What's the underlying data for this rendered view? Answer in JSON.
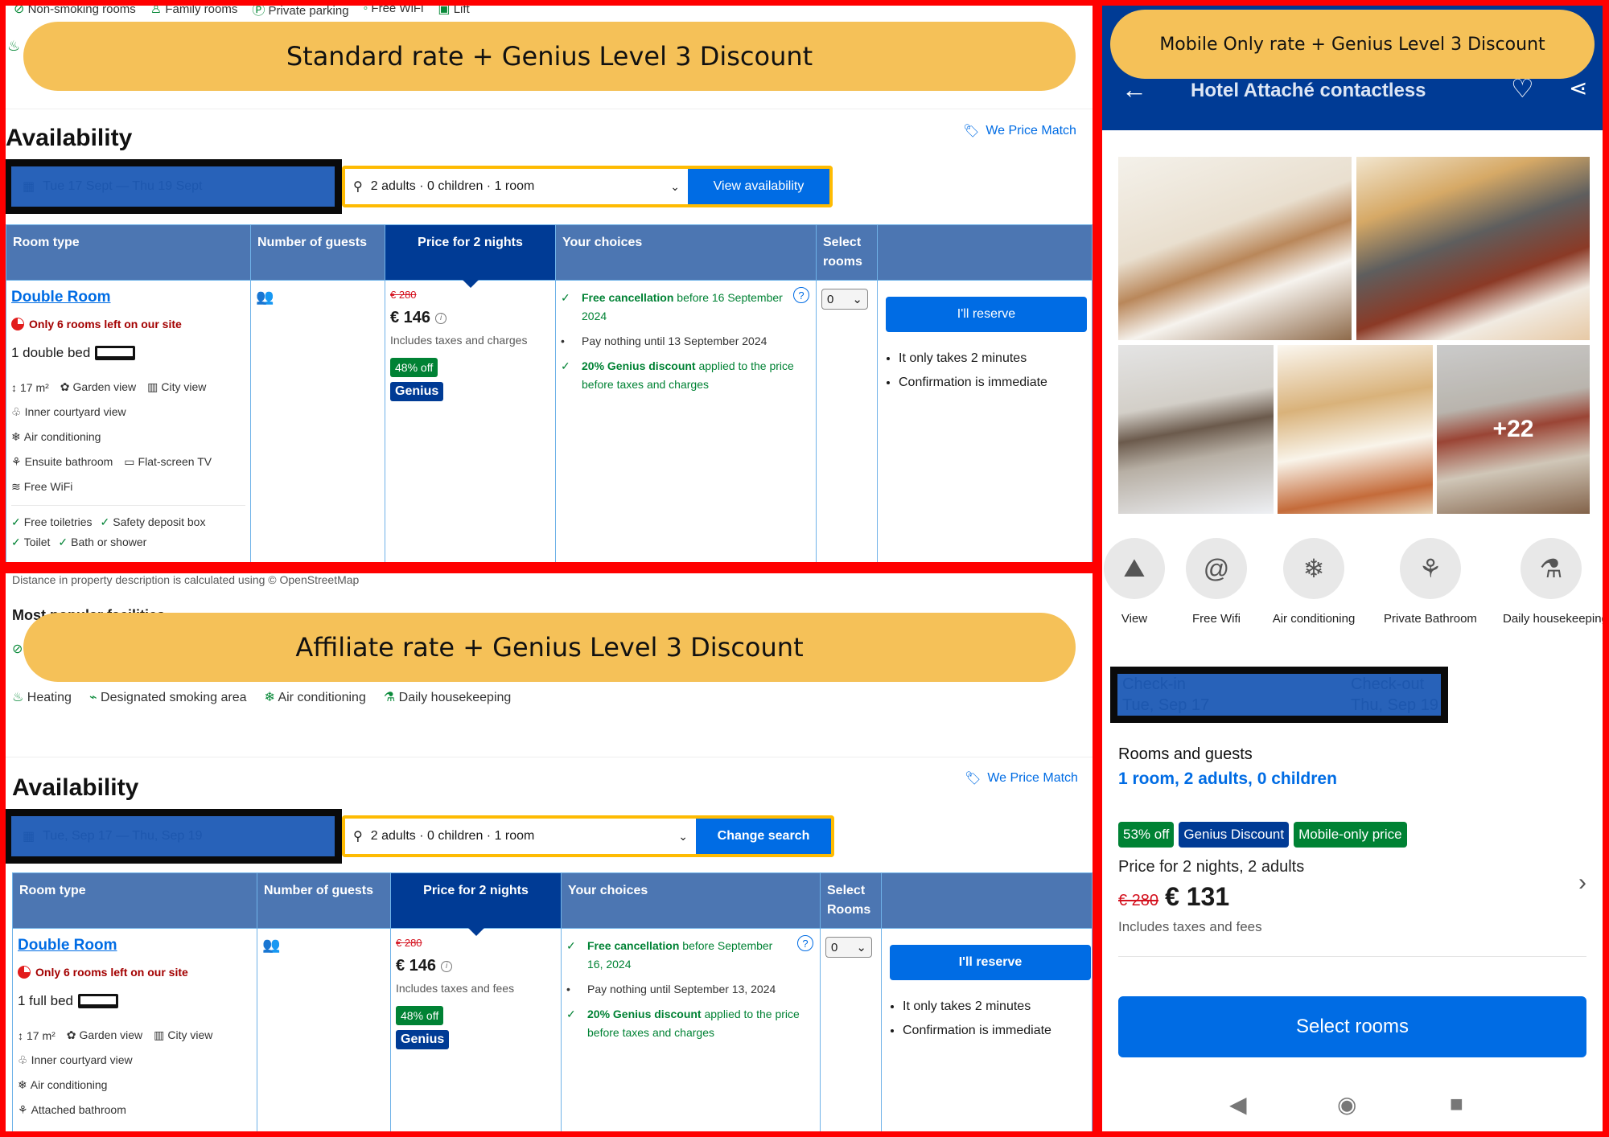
{
  "panels": {
    "standard": {
      "banner": "Standard rate + Genius Level 3 Discount",
      "top_facilities": [
        "Non-smoking rooms",
        "Family rooms",
        "Private parking",
        "Free WiFi",
        "Lift"
      ],
      "availability_title": "Availability",
      "price_match": "We Price Match",
      "dates": "Tue 17 Sept — Thu 19 Sept",
      "guests": "2 adults · 0 children · 1 room",
      "search_button": "View availability",
      "headers": [
        "Room type",
        "Number of guests",
        "Price for 2 nights",
        "Your choices",
        "Select rooms",
        ""
      ],
      "room": {
        "name": "Double Room",
        "scarcity": "Only 6 rooms left on our site",
        "bed": "1 double bed",
        "size": "17 m²",
        "facilities_rows": [
          [
            "17 m²",
            "Garden view",
            "City view"
          ],
          [
            "Inner courtyard view"
          ],
          [
            "Air conditioning"
          ],
          [
            "Ensuite bathroom",
            "Flat-screen TV"
          ],
          [
            "Free WiFi"
          ]
        ],
        "checks": [
          [
            "Free toiletries",
            "Safety deposit box"
          ],
          [
            "Toilet",
            "Bath or shower"
          ]
        ],
        "old_price": "€ 280",
        "price": "€ 146",
        "tax_note": "Includes taxes and charges",
        "discount_badge": "48% off",
        "genius_badge": "Genius",
        "choice1_bold": "Free cancellation",
        "choice1_rest": " before 16 September 2024",
        "choice2": "Pay nothing until 13 September 2024",
        "choice3_bold": "20% Genius discount",
        "choice3_rest": " applied to the price before taxes and charges",
        "qty": "0",
        "reserve": "I'll reserve",
        "bullets": [
          "It only takes 2 minutes",
          "Confirmation is immediate"
        ]
      }
    },
    "affiliate": {
      "banner": "Affiliate rate + Genius Level 3 Discount",
      "osm_note": "Distance in property description is calculated using © OpenStreetMap",
      "most_popular": "Most popular facilities",
      "facilities": [
        "Heating",
        "Designated smoking area",
        "Air conditioning",
        "Daily housekeeping"
      ],
      "availability_title": "Availability",
      "price_match": "We Price Match",
      "dates": "Tue, Sep 17 — Thu, Sep 19",
      "guests": "2 adults · 0 children · 1 room",
      "search_button": "Change search",
      "headers": [
        "Room type",
        "Number of guests",
        "Price for 2 nights",
        "Your choices",
        "Select Rooms",
        ""
      ],
      "room": {
        "name": "Double Room",
        "scarcity": "Only 6 rooms left on our site",
        "bed": "1 full bed",
        "facilities_rows": [
          [
            "17 m²",
            "Garden view",
            "City view"
          ],
          [
            "Inner courtyard view"
          ],
          [
            "Air conditioning"
          ],
          [
            "Attached bathroom"
          ]
        ],
        "old_price": "€ 280",
        "price": "€ 146",
        "tax_note": "Includes taxes and fees",
        "discount_badge": "48% off",
        "genius_badge": "Genius",
        "choice1_bold": "Free cancellation",
        "choice1_rest": " before September 16, 2024",
        "choice2": "Pay nothing until September 13, 2024",
        "choice3_bold": "20% Genius discount",
        "choice3_rest": " applied to the price before taxes and charges",
        "qty": "0",
        "reserve": "I'll reserve",
        "bullets": [
          "It only takes 2 minutes",
          "Confirmation is immediate"
        ]
      }
    },
    "mobile": {
      "banner": "Mobile Only rate + Genius Level 3 Discount",
      "hotel_name": "Hotel Attaché contactless",
      "more_photos": "+22",
      "amenities": [
        "View",
        "Free Wifi",
        "Air conditioning",
        "Private Bathroom",
        "Daily housekeeping"
      ],
      "checkin_label": "Check-in",
      "checkin_date": "Tue, Sep 17",
      "checkout_label": "Check-out",
      "checkout_date": "Thu, Sep 19",
      "rooms_guests_label": "Rooms and guests",
      "rooms_guests_value": "1 room, 2 adults, 0 children",
      "badges": [
        "53% off",
        "Genius Discount",
        "Mobile-only price"
      ],
      "price_for": "Price for 2 nights, 2 adults",
      "old_price": "€ 280",
      "price": "€ 131",
      "tax_note": "Includes taxes and fees",
      "select_button": "Select rooms"
    }
  },
  "colors": {
    "frame": "#ff0000",
    "banner": "#f5c158",
    "booking_blue": "#003b95",
    "action_blue": "#006ce4",
    "table_header": "#4c76b2",
    "green": "#008234",
    "scarcity_red": "#a30000"
  }
}
